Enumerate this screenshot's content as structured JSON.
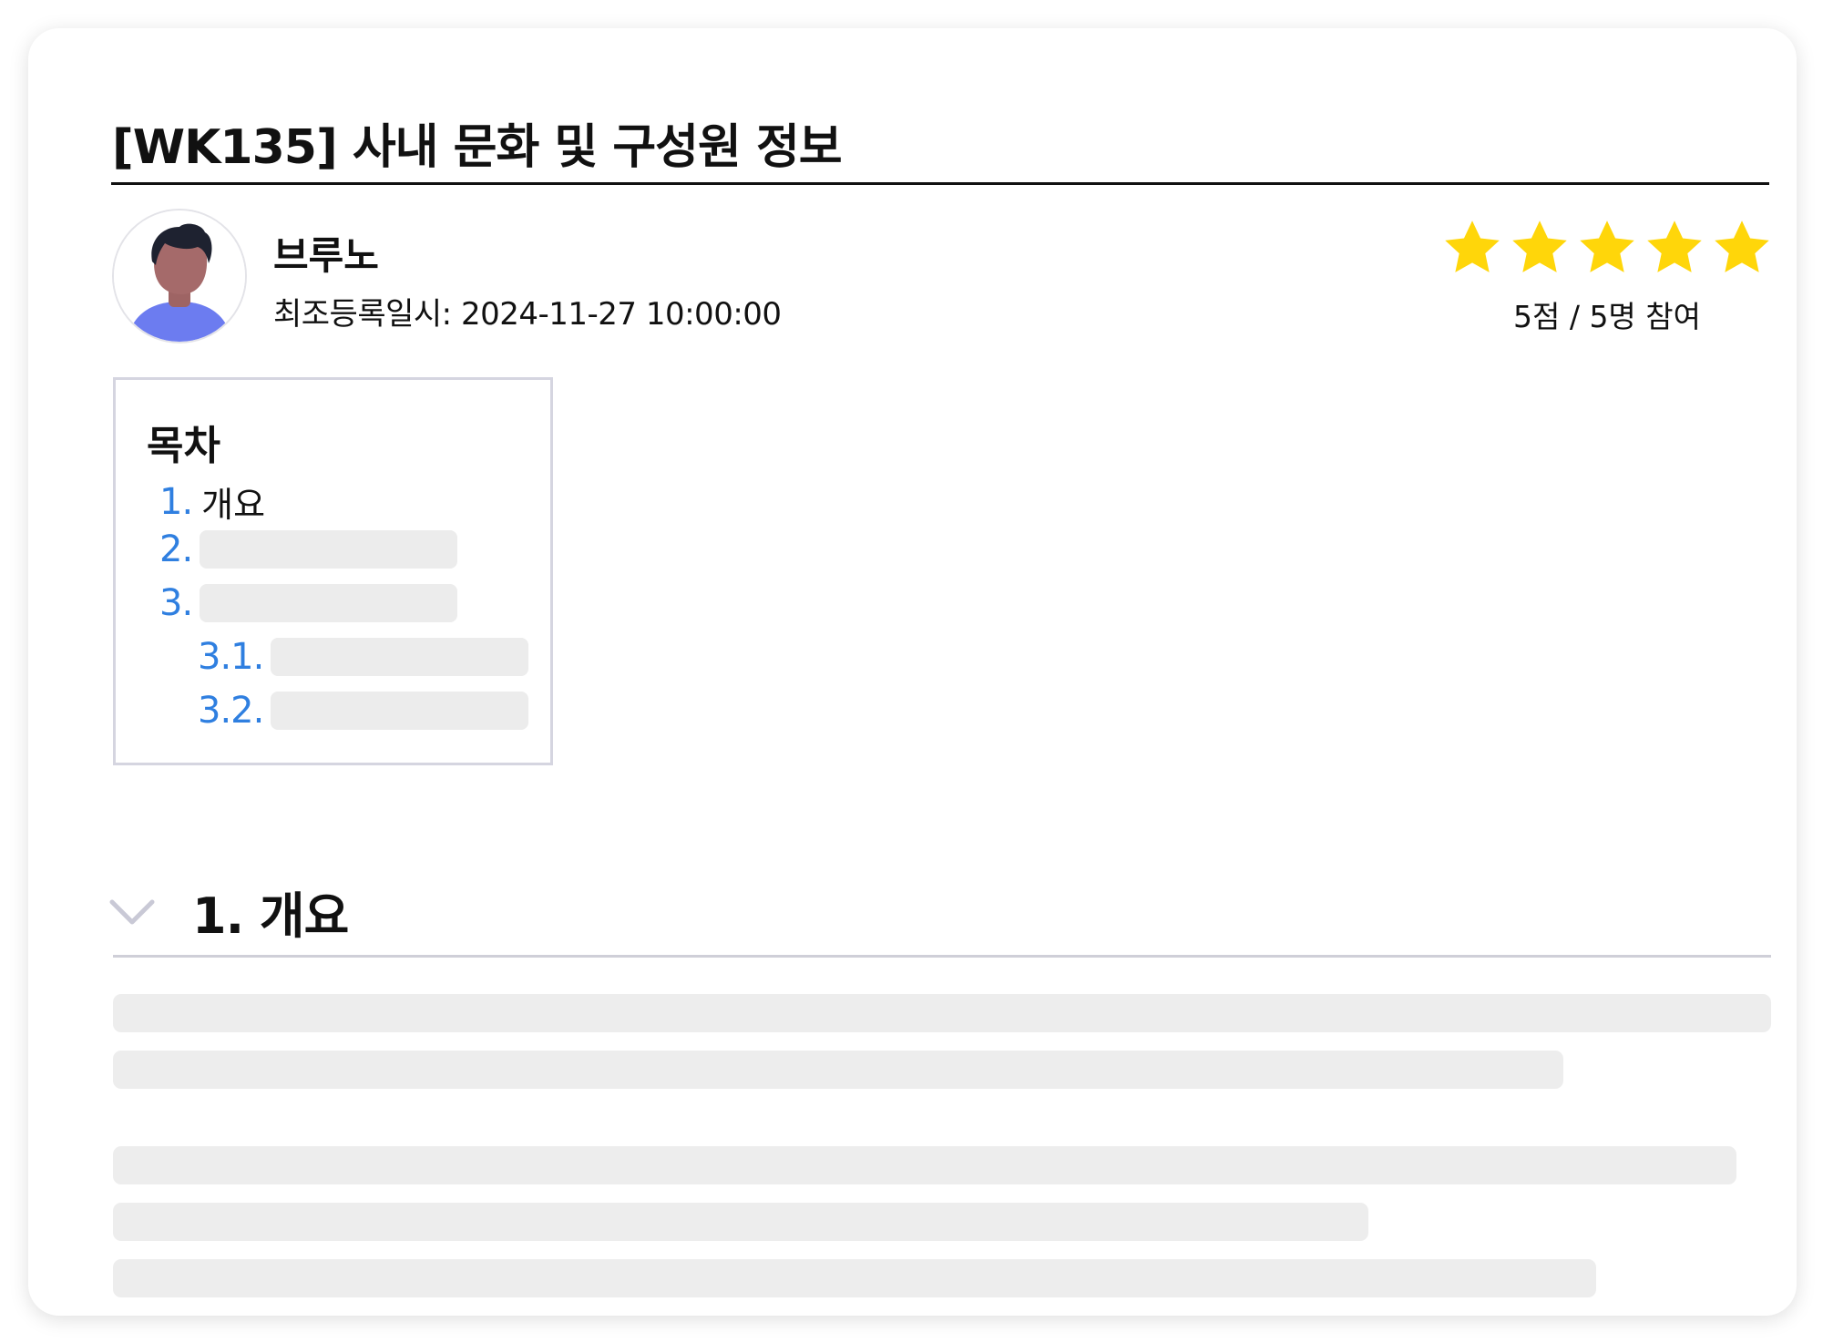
{
  "document": {
    "title": "[WK135] 사내 문화 및 구성원 정보"
  },
  "author": {
    "name": "브루노",
    "registered": "최조등록일시: 2024-11-27 10:00:00"
  },
  "rating": {
    "stars": 5,
    "max_stars": 5,
    "text": "5점 / 5명 참여",
    "star_color": "#FFD60A"
  },
  "toc": {
    "title": "목차",
    "items": [
      {
        "num": "1.",
        "text": "개요"
      },
      {
        "num": "2.",
        "text": ""
      },
      {
        "num": "3.",
        "text": ""
      },
      {
        "num": "3.1.",
        "text": ""
      },
      {
        "num": "3.2.",
        "text": ""
      }
    ],
    "number_color": "#2F7FE0"
  },
  "section": {
    "title": "1. 개요",
    "toggle_icon": "chevron-down-icon"
  },
  "colors": {
    "placeholder": "#EDEDED",
    "card_background": "#FFFFFF"
  }
}
